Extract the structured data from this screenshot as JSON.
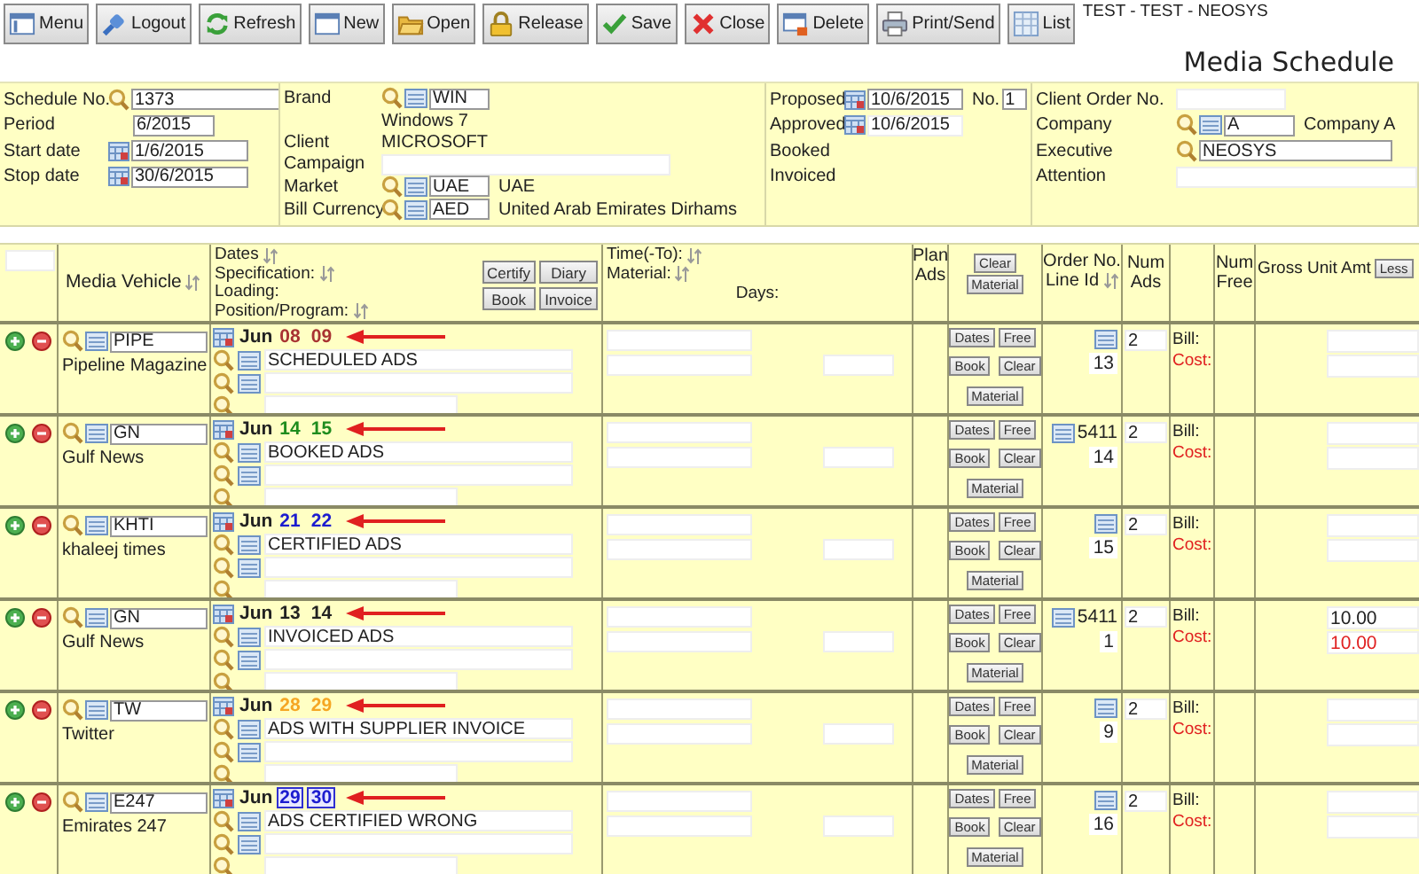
{
  "toolbar": {
    "buttons": [
      {
        "label": "Menu"
      },
      {
        "label": "Logout"
      },
      {
        "label": "Refresh"
      },
      {
        "label": "New"
      },
      {
        "label": "Open"
      },
      {
        "label": "Release"
      },
      {
        "label": "Save"
      },
      {
        "label": "Close"
      },
      {
        "label": "Delete"
      },
      {
        "label": "Print/Send"
      },
      {
        "label": "List"
      }
    ],
    "context": "TEST - TEST - NEOSYS"
  },
  "page_title": "Media Schedule",
  "header": {
    "schedule": {
      "schedule_no_label": "Schedule No.",
      "schedule_no": "1373",
      "period_label": "Period",
      "period": "6/2015",
      "start_label": "Start date",
      "start": "1/6/2015",
      "stop_label": "Stop date",
      "stop": "30/6/2015"
    },
    "brand": {
      "brand_label": "Brand",
      "brand_code": "WIN",
      "brand_name": "Windows 7",
      "client_label": "Client",
      "client": "MICROSOFT",
      "campaign_label": "Campaign",
      "market_label": "Market",
      "market_code": "UAE",
      "market_name": "UAE",
      "currency_label": "Bill Currency",
      "currency_code": "AED",
      "currency_name": "United Arab Emirates Dirhams"
    },
    "status": {
      "proposed_label": "Proposed",
      "proposed": "10/6/2015",
      "no_label": "No.",
      "no": "1",
      "approved_label": "Approved",
      "approved": "10/6/2015",
      "booked_label": "Booked",
      "invoiced_label": "Invoiced"
    },
    "client": {
      "order_label": "Client Order No.",
      "company_label": "Company",
      "company_code": "A",
      "company_name": "Company A",
      "executive_label": "Executive",
      "executive": "NEOSYS",
      "attention_label": "Attention"
    }
  },
  "table": {
    "header": {
      "vehicle": {
        "text": "Media Vehicle",
        "sortable": true
      },
      "dates": [
        {
          "text": "Dates",
          "sortable": true
        },
        {
          "text": "Specification:",
          "sortable": true
        },
        {
          "text": "Loading:",
          "sortable": false
        },
        {
          "text": "Position/Program:",
          "sortable": true
        }
      ],
      "date_buttons": [
        "Certify",
        "Diary",
        "Book",
        "Invoice"
      ],
      "time": [
        {
          "text": "Time(-To):",
          "sortable": true
        },
        {
          "text": "Material:",
          "sortable": true
        }
      ],
      "days": "Days:",
      "plan_ads": "Plan Ads",
      "line_buttons": [
        "Clear",
        "Material"
      ],
      "order": {
        "lines": [
          "Order No.",
          "Line Id"
        ],
        "sortable": true
      },
      "num_ads": "Num Ads",
      "num_free": "Num Free",
      "gross": "Gross Unit Amt",
      "less_button": "Less"
    },
    "rows": [
      {
        "vehicle_code": "PIPE",
        "vehicle_name": "Pipeline Magazine",
        "month": "Jun",
        "days": [
          {
            "text": "08",
            "color": "#a83232",
            "boxed": false
          },
          {
            "text": "09",
            "color": "#a83232",
            "boxed": false
          }
        ],
        "arrow": true,
        "specification": "SCHEDULED ADS",
        "buttons": [
          "Dates",
          "Free",
          "Book",
          "Clear",
          "Material"
        ],
        "line_id": "13",
        "num_ads": "2",
        "bill_label": "Bill:",
        "cost_label": "Cost:"
      },
      {
        "vehicle_code": "GN",
        "vehicle_name": "Gulf News",
        "month": "Jun",
        "days": [
          {
            "text": "14",
            "color": "#1e8c1e",
            "boxed": false
          },
          {
            "text": "15",
            "color": "#1e8c1e",
            "boxed": false
          }
        ],
        "arrow": true,
        "specification": "BOOKED ADS",
        "buttons": [
          "Dates",
          "Free",
          "Book",
          "Clear",
          "Material"
        ],
        "order_no": "5411",
        "line_id": "14",
        "num_ads": "2",
        "bill_label": "Bill:",
        "cost_label": "Cost:"
      },
      {
        "vehicle_code": "KHTI",
        "vehicle_name": "khaleej times",
        "month": "Jun",
        "days": [
          {
            "text": "21",
            "color": "#1c1ccf",
            "boxed": false
          },
          {
            "text": "22",
            "color": "#1c1ccf",
            "boxed": false
          }
        ],
        "arrow": true,
        "specification": "CERTIFIED ADS",
        "buttons": [
          "Dates",
          "Free",
          "Book",
          "Clear",
          "Material"
        ],
        "line_id": "15",
        "num_ads": "2",
        "bill_label": "Bill:",
        "cost_label": "Cost:"
      },
      {
        "vehicle_code": "GN",
        "vehicle_name": "Gulf News",
        "month": "Jun",
        "days": [
          {
            "text": "13",
            "color": "#222222",
            "boxed": false
          },
          {
            "text": "14",
            "color": "#222222",
            "boxed": false
          }
        ],
        "arrow": true,
        "specification": "INVOICED ADS",
        "buttons": [
          "Dates",
          "Free",
          "Book",
          "Clear",
          "Material"
        ],
        "order_no": "5411",
        "line_id": "1",
        "num_ads": "2",
        "bill_label": "Bill:",
        "cost_label": "Cost:",
        "gross_bill": "10.00",
        "gross_cost": "10.00"
      },
      {
        "vehicle_code": "TW",
        "vehicle_name": "Twitter",
        "month": "Jun",
        "days": [
          {
            "text": "28",
            "color": "#f5a623",
            "boxed": false
          },
          {
            "text": "29",
            "color": "#f5a623",
            "boxed": false
          }
        ],
        "arrow": true,
        "specification": "ADS WITH SUPPLIER INVOICE",
        "buttons": [
          "Dates",
          "Free",
          "Book",
          "Clear",
          "Material"
        ],
        "line_id": "9",
        "num_ads": "2",
        "bill_label": "Bill:",
        "cost_label": "Cost:"
      },
      {
        "vehicle_code": "E247",
        "vehicle_name": "Emirates 247",
        "month": "Jun",
        "days": [
          {
            "text": "29",
            "color": "#1c1ccf",
            "boxed": true
          },
          {
            "text": "30",
            "color": "#1c1ccf",
            "boxed": true
          }
        ],
        "arrow": true,
        "specification": "ADS CERTIFIED WRONG",
        "buttons": [
          "Dates",
          "Free",
          "Book",
          "Clear",
          "Material"
        ],
        "line_id": "16",
        "num_ads": "2",
        "bill_label": "Bill:",
        "cost_label": "Cost:"
      }
    ]
  }
}
